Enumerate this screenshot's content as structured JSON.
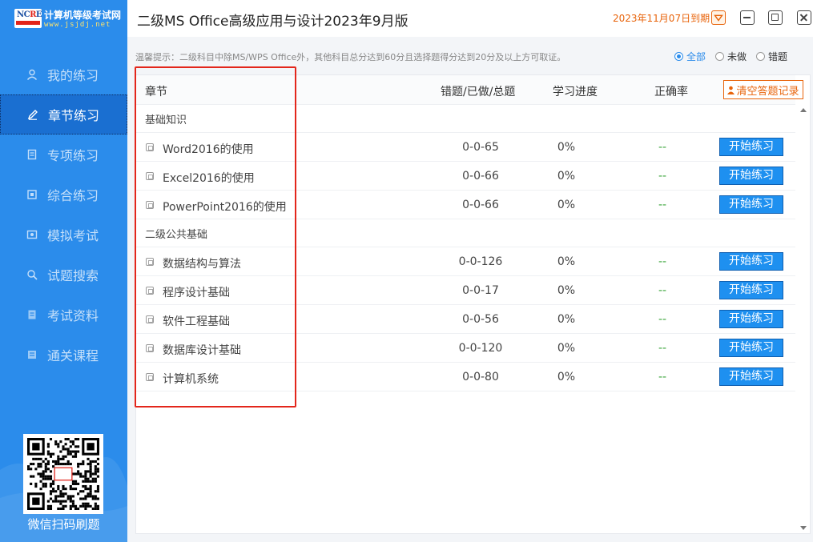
{
  "logo": {
    "badge": "NCRE",
    "title": "计算机等级考试网",
    "url": "www.jsjdj.net"
  },
  "window": {
    "title": "二级MS Office高级应用与设计2023年9月版",
    "expiry": "2023年11月07日到期"
  },
  "sidebar": {
    "items": [
      {
        "label": "我的练习",
        "icon": "user-icon"
      },
      {
        "label": "章节练习",
        "icon": "pencil-icon",
        "active": true
      },
      {
        "label": "专项练习",
        "icon": "document-icon"
      },
      {
        "label": "综合练习",
        "icon": "layers-icon"
      },
      {
        "label": "模拟考试",
        "icon": "exam-icon"
      },
      {
        "label": "试题搜索",
        "icon": "search-icon"
      },
      {
        "label": "考试资料",
        "icon": "book-icon"
      },
      {
        "label": "通关课程",
        "icon": "course-icon"
      }
    ],
    "qr_caption": "微信扫码刷题"
  },
  "tip": "温馨提示：二级科目中除MS/WPS Office外，其他科目总分达到60分且选择题得分达到20分及以上方可取证。",
  "filters": [
    {
      "label": "全部",
      "selected": true
    },
    {
      "label": "未做",
      "selected": false
    },
    {
      "label": "错题",
      "selected": false
    }
  ],
  "table": {
    "headers": {
      "chapter": "章节",
      "stats": "错题/已做/总题",
      "progress": "学习进度",
      "accuracy": "正确率"
    },
    "clear_label": "清空答题记录",
    "start_label": "开始练习",
    "groups": [
      {
        "title": "基础知识",
        "rows": [
          {
            "name": "Word2016的使用",
            "stats": "0-0-65",
            "progress": "0%",
            "accuracy": "--"
          },
          {
            "name": "Excel2016的使用",
            "stats": "0-0-66",
            "progress": "0%",
            "accuracy": "--"
          },
          {
            "name": "PowerPoint2016的使用",
            "stats": "0-0-66",
            "progress": "0%",
            "accuracy": "--"
          }
        ]
      },
      {
        "title": "二级公共基础",
        "rows": [
          {
            "name": "数据结构与算法",
            "stats": "0-0-126",
            "progress": "0%",
            "accuracy": "--"
          },
          {
            "name": "程序设计基础",
            "stats": "0-0-17",
            "progress": "0%",
            "accuracy": "--"
          },
          {
            "name": "软件工程基础",
            "stats": "0-0-56",
            "progress": "0%",
            "accuracy": "--"
          },
          {
            "name": "数据库设计基础",
            "stats": "0-0-120",
            "progress": "0%",
            "accuracy": "--"
          },
          {
            "name": "计算机系统",
            "stats": "0-0-80",
            "progress": "0%",
            "accuracy": "--"
          }
        ]
      }
    ]
  },
  "colors": {
    "sidebar": "#2b8ceb",
    "accent": "#e8630a",
    "start_button": "#1e90f0",
    "highlight": "#e3261b"
  }
}
